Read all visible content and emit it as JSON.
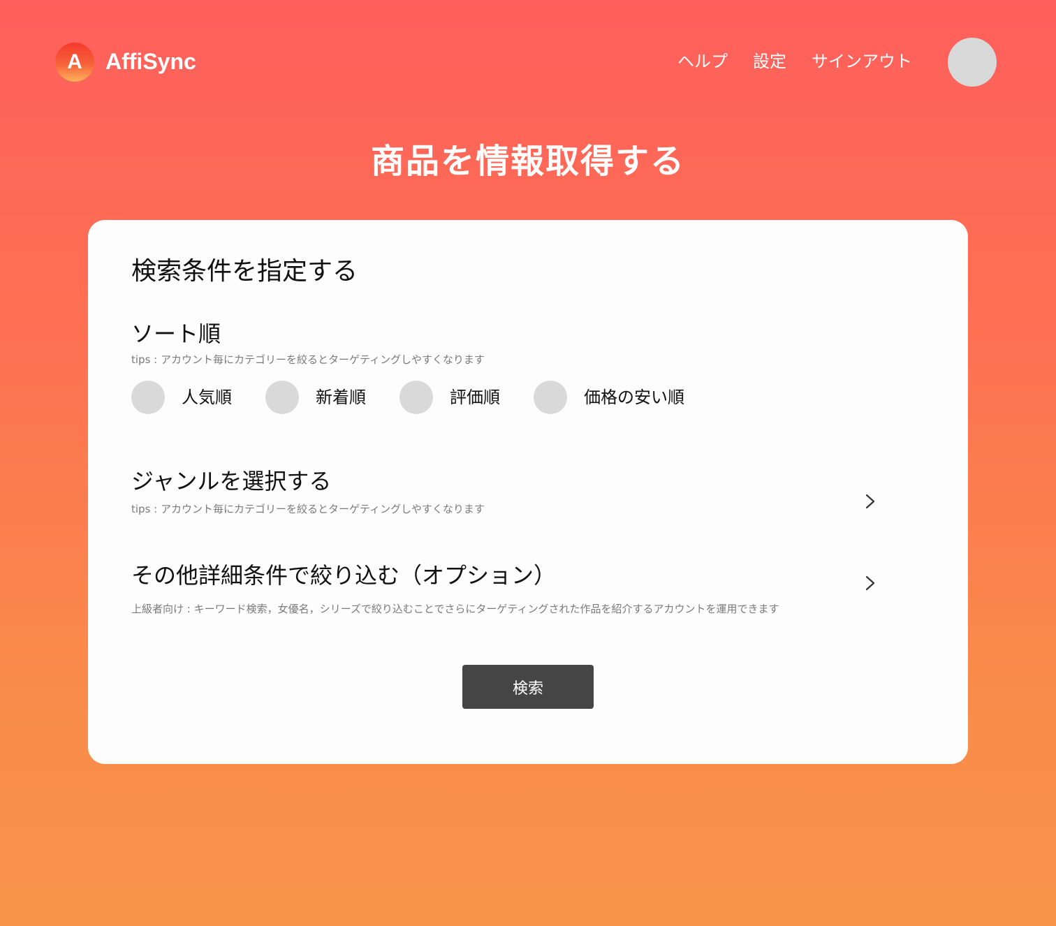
{
  "header": {
    "logo_letter": "A",
    "brand": "AffiSync",
    "nav": {
      "help": "ヘルプ",
      "settings": "設定",
      "signout": "サインアウト"
    }
  },
  "page_title": "商品を情報取得する",
  "card": {
    "title": "検索条件を指定する",
    "sort": {
      "title": "ソート順",
      "tips": "tips : アカウント毎にカテゴリーを絞るとターゲティングしやすくなります",
      "options": [
        "人気順",
        "新着順",
        "評価順",
        "価格の安い順"
      ]
    },
    "genre": {
      "title": "ジャンルを選択する",
      "tips": "tips : アカウント毎にカテゴリーを絞るとターゲティングしやすくなります"
    },
    "detail": {
      "title": "その他詳細条件で絞り込む（オプション）",
      "tips": "上級者向け : キーワード検索，女優名，シリーズで絞り込むことでさらにターゲティングされた作品を紹介するアカウントを運用できます"
    },
    "search_button": "検索"
  },
  "colors": {
    "background_top": "#ff5f5c",
    "background_bottom": "#f8944a",
    "button": "#454545",
    "radio": "#d9d9d9"
  },
  "icons": {
    "chevron": "chevron-right-icon"
  }
}
